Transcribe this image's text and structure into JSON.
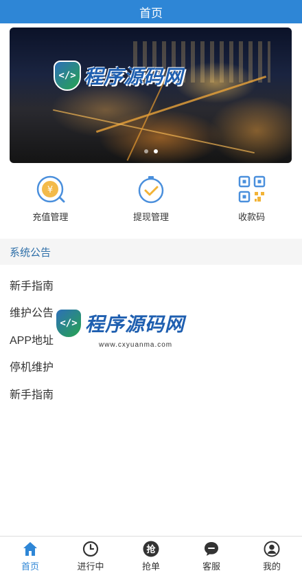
{
  "header": {
    "title": "首页"
  },
  "banner": {
    "slides": 2,
    "active_slide": 2
  },
  "watermark": {
    "brand": "程序源码网",
    "url": "www.cxyuanma.com"
  },
  "quick_actions": [
    {
      "label": "充值管理",
      "icon": "yen-circle-icon"
    },
    {
      "label": "提现管理",
      "icon": "clock-check-icon"
    },
    {
      "label": "收款码",
      "icon": "qr-code-icon"
    }
  ],
  "notice": {
    "title": "系统公告",
    "items": [
      "新手指南",
      "维护公告",
      "APP地址",
      "停机维护",
      "新手指南"
    ]
  },
  "tabbar": [
    {
      "label": "首页",
      "icon": "home-icon",
      "active": true
    },
    {
      "label": "进行中",
      "icon": "clock-icon",
      "active": false
    },
    {
      "label": "抢单",
      "icon": "grab-order-icon",
      "active": false
    },
    {
      "label": "客服",
      "icon": "chat-bubble-icon",
      "active": false
    },
    {
      "label": "我的",
      "icon": "user-icon",
      "active": false
    }
  ],
  "colors": {
    "primary": "#2e86d6",
    "notice_title": "#2e6fa8",
    "icon_blue": "#4a8fdc",
    "icon_yellow": "#f2b336"
  }
}
